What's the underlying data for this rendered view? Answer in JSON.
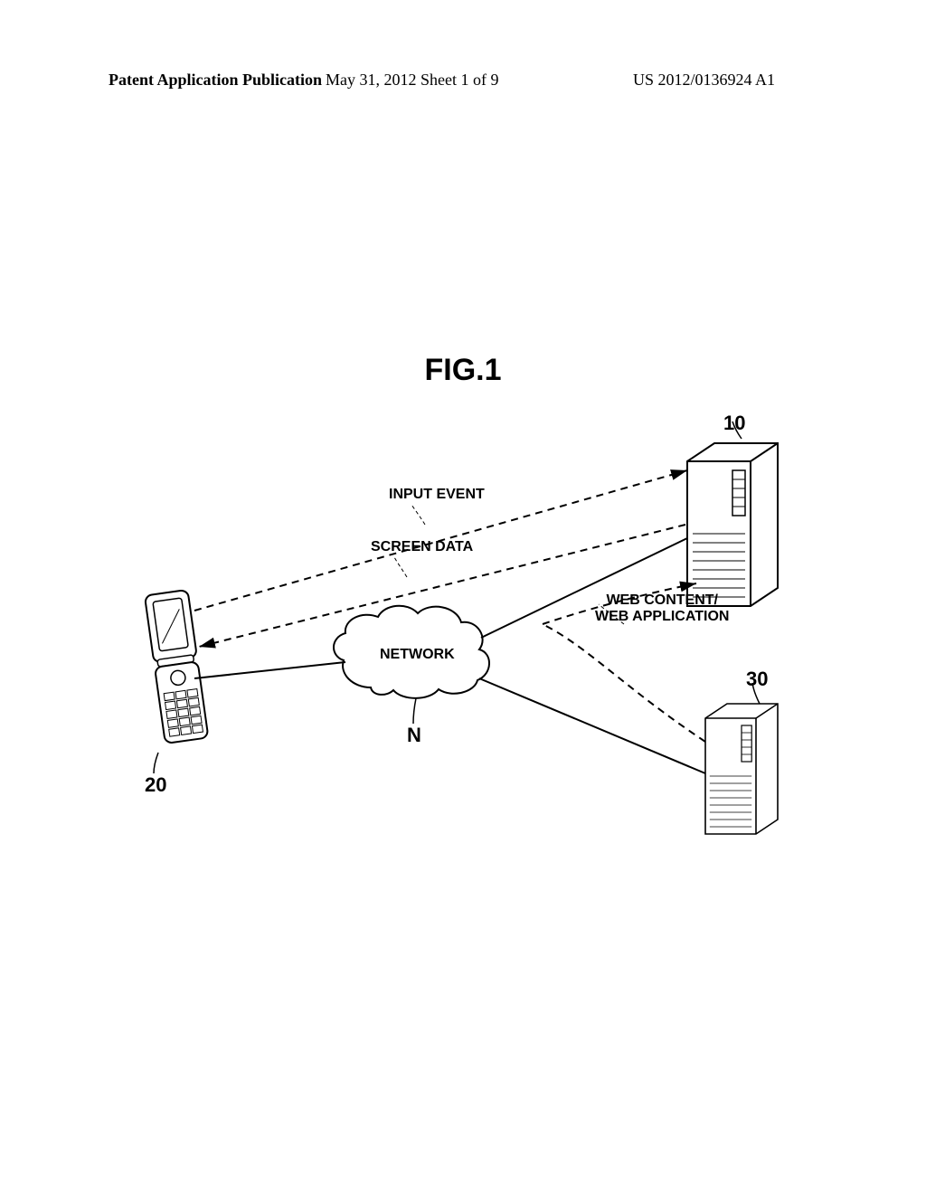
{
  "header": {
    "left": "Patent Application Publication",
    "center": "May 31, 2012  Sheet 1 of 9",
    "right": "US 2012/0136924 A1"
  },
  "figure": {
    "title": "FIG.1"
  },
  "labels": {
    "input_event": "INPUT EVENT",
    "screen_data": "SCREEN DATA",
    "web_content": "WEB CONTENT/\nWEB APPLICATION",
    "network": "NETWORK"
  },
  "refs": {
    "server1": "10",
    "phone": "20",
    "server2": "30",
    "network": "N"
  }
}
